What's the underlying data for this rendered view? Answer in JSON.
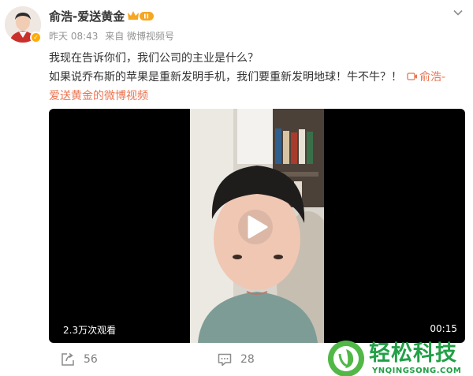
{
  "post": {
    "author": "俞浩-爱送黄金",
    "meta": {
      "time": "昨天 08:43",
      "source": "来自 微博视频号"
    },
    "content": {
      "line1": "我现在告诉你们，我们公司的主业是什么？",
      "line2": "如果说乔布斯的苹果是重新发明手机，我们要重新发明地球！牛不牛？！",
      "link_part1": "俞浩-",
      "link_part2": "爱送黄金的微博视频"
    },
    "video": {
      "views": "2.3万次观看",
      "duration": "00:15"
    },
    "actions": {
      "repost_count": "56",
      "comment_count": "28"
    }
  },
  "watermark": {
    "title": "轻松科技",
    "domain": "YNQINGSONG.COM"
  },
  "colors": {
    "link": "#eb7350",
    "meta": "#939393",
    "watermark_green": "#21a046",
    "verified": "#ffab00"
  },
  "icons": [
    "avatar",
    "verified-badge-icon",
    "rank-badge-icon",
    "chevron-down-icon",
    "video-link-icon",
    "play-icon",
    "repost-icon",
    "comment-icon",
    "watermark-logo-icon"
  ]
}
